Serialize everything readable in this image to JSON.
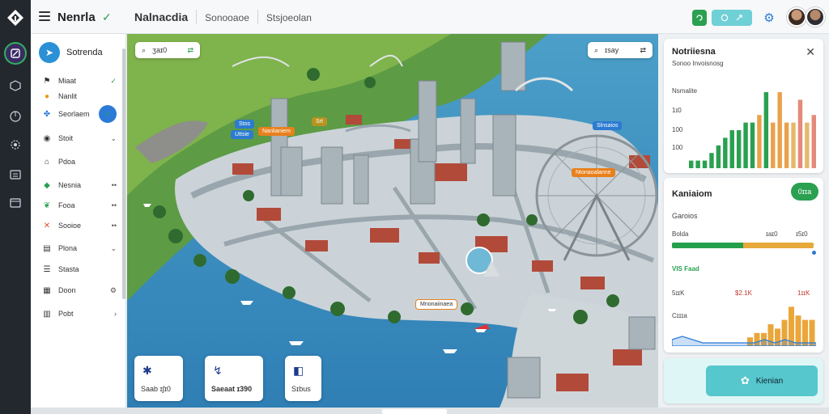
{
  "app": {
    "name": "Nenrla"
  },
  "breadcrumb": [
    "Nalnacdia",
    "Sonooaoe",
    "Stsjoeolan"
  ],
  "sidebar": {
    "header": "Sotrenda",
    "items": [
      {
        "label": "Miaat",
        "icon": "bookmark-icon",
        "trail": "✓"
      },
      {
        "label": "Nanlit",
        "icon": "award-icon",
        "trail": ""
      },
      {
        "label": "Seorlaem",
        "icon": "community-icon",
        "trail": "✓"
      },
      {
        "label": "Stoit",
        "icon": "pin-icon",
        "trail": "⌄"
      },
      {
        "label": "Pdoa",
        "icon": "home-icon",
        "trail": ""
      },
      {
        "label": "Nesnia",
        "icon": "tag-icon",
        "trail": "••"
      },
      {
        "label": "Fooa",
        "icon": "leaf-icon",
        "trail": "••"
      },
      {
        "label": "Sooioe",
        "icon": "cross-icon",
        "trail": "••"
      },
      {
        "label": "Plona",
        "icon": "doc-icon",
        "trail": "⌄"
      },
      {
        "label": "Stasta",
        "icon": "list-icon",
        "trail": ""
      },
      {
        "label": "Doon",
        "icon": "grid-icon",
        "trail": "⚙"
      },
      {
        "label": "Pobt",
        "icon": "table-icon",
        "trail": "›"
      }
    ]
  },
  "map": {
    "search_left": "ʒaɪ0",
    "search_right": "ɪsay",
    "labels": [
      {
        "text": "Stos",
        "color": "#2c7bd1"
      },
      {
        "text": "Nanlianiem",
        "color": "#e8801c"
      },
      {
        "text": "Uttsie",
        "color": "#2c7bd1"
      },
      {
        "text": "Srt",
        "color": "#b79320"
      },
      {
        "text": "Slnsaios",
        "color": "#2c7bd1"
      },
      {
        "text": "Ntonaoalanne",
        "color": "#e8801c"
      },
      {
        "text": "Mnonaiinaea",
        "color": "#e8801c"
      }
    ],
    "cards": [
      {
        "label": "Saab ɪʃɪ0"
      },
      {
        "label": "Saeaat ɪ390"
      },
      {
        "label": "Sɪbus"
      }
    ]
  },
  "right_panel": {
    "title": "Notriiesna",
    "subtitle": "Sonoo Invoisnosg",
    "chart_label": "Nsmalite",
    "yticks": [
      "1ɪ0",
      "100",
      "100"
    ],
    "status_title": "Kaniaiom",
    "badge": "0ɪɪa",
    "status_sub": "Garoios",
    "bar_label": "Bolda",
    "bar_vals": [
      "ɪaɪ0",
      "ɪ5ɪ0"
    ],
    "bar_fraction": 0.5,
    "progress_label": "VIS Faad",
    "value_row": [
      "5ɪɪK",
      "$2.1K",
      "1ɪɪK"
    ],
    "value_sub": "Cɪɪɪa",
    "action_label": "Kienian"
  },
  "colors": {
    "accent": "#2aa050",
    "blue": "#2b7bd6",
    "teal": "#5ccfd0",
    "orange": "#e8801c"
  },
  "chart_data": [
    {
      "type": "bar",
      "ylabel": "",
      "series": [
        {
          "values": [
            1,
            1,
            1,
            2,
            3,
            4,
            5,
            5,
            6,
            6,
            7,
            10,
            6,
            10,
            6,
            6,
            9,
            6,
            7
          ]
        }
      ]
    },
    {
      "type": "area",
      "series": [
        {
          "values": [
            2,
            3,
            2,
            1,
            1,
            1,
            1,
            1,
            1,
            2,
            1,
            2,
            1,
            1,
            1
          ]
        }
      ],
      "bars": [
        2,
        3,
        3,
        5,
        4,
        6,
        9,
        7,
        6,
        6
      ]
    }
  ]
}
